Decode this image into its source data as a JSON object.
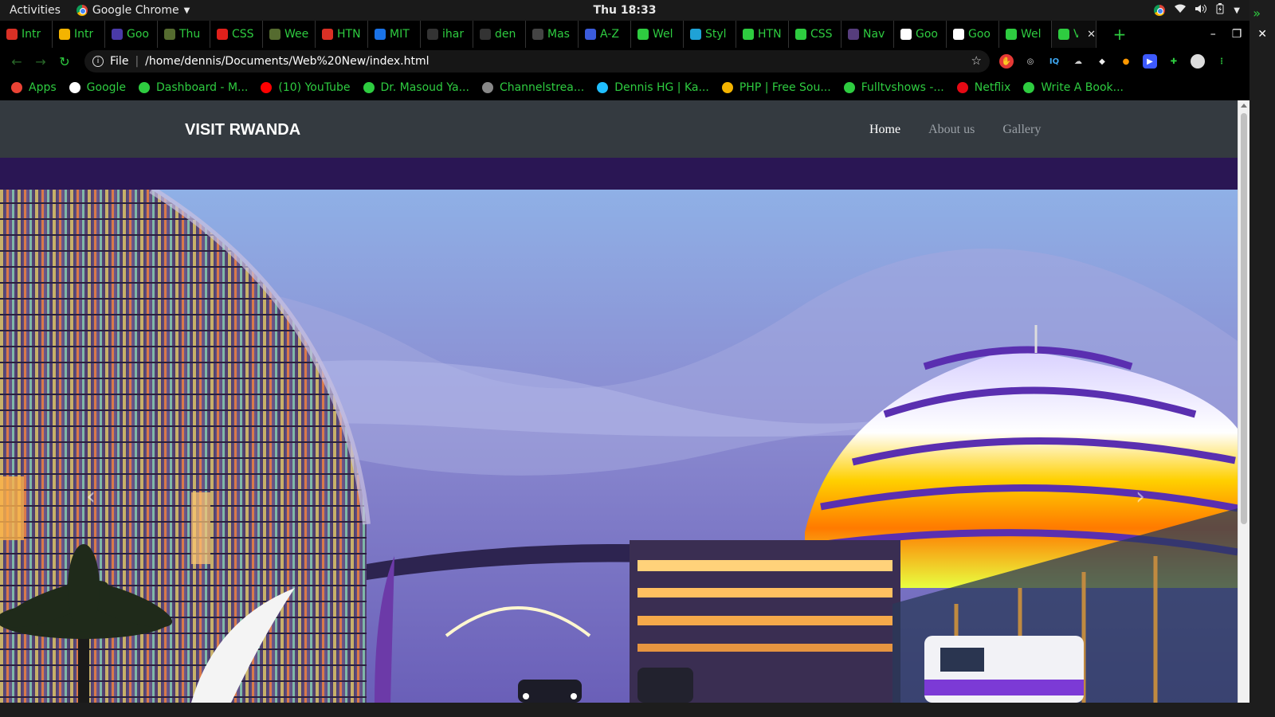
{
  "system_bar": {
    "activities": "Activities",
    "app_name": "Google Chrome",
    "clock": "Thu 18:33"
  },
  "tabs": [
    {
      "label": "Intr",
      "icon": "gmail-icon",
      "color": "#d93025"
    },
    {
      "label": "Intr",
      "icon": "slides-icon",
      "color": "#f4b400"
    },
    {
      "label": "Goo",
      "icon": "calendar-icon",
      "color": "#4a3aa8"
    },
    {
      "label": "Thu",
      "icon": "plant-icon",
      "color": "#556b2f"
    },
    {
      "label": "CSS",
      "icon": "opera-icon",
      "color": "#e0201b"
    },
    {
      "label": "Wee",
      "icon": "plant-icon",
      "color": "#556b2f"
    },
    {
      "label": "HTN",
      "icon": "ring-icon",
      "color": "#d93025"
    },
    {
      "label": "MIT",
      "icon": "question-icon",
      "color": "#1a73e8"
    },
    {
      "label": "ihar",
      "icon": "github-icon",
      "color": "#333333"
    },
    {
      "label": "den",
      "icon": "github-icon",
      "color": "#333333"
    },
    {
      "label": "Mas",
      "icon": "github-icon",
      "color": "#444444"
    },
    {
      "label": "A-Z",
      "icon": "info-icon",
      "color": "#3b5bdb"
    },
    {
      "label": "Wel",
      "icon": "globe-icon",
      "color": "#2ecc40"
    },
    {
      "label": "Styl",
      "icon": "puzzle-icon",
      "color": "#1fa2d6"
    },
    {
      "label": "HTN",
      "icon": "w3-icon",
      "color": "#2ecc40"
    },
    {
      "label": "CSS",
      "icon": "w3-icon",
      "color": "#2ecc40"
    },
    {
      "label": "Nav",
      "icon": "bootstrap-icon",
      "color": "#563d7c"
    },
    {
      "label": "Goo",
      "icon": "google-icon",
      "color": "#ffffff"
    },
    {
      "label": "Goo",
      "icon": "google-icon",
      "color": "#ffffff"
    },
    {
      "label": "Wel",
      "icon": "globe-icon",
      "color": "#2ecc40"
    },
    {
      "label": "V",
      "icon": "globe-icon",
      "color": "#2ecc40",
      "active": true
    }
  ],
  "toolbar": {
    "scheme": "File",
    "url": "/home/dennis/Documents/Web%20New/index.html"
  },
  "bookmarks": [
    {
      "label": "Apps",
      "icon": "apps-grid-icon",
      "color": "#ea4335"
    },
    {
      "label": "Google",
      "icon": "google-icon",
      "color": "#ffffff"
    },
    {
      "label": "Dashboard - M...",
      "icon": "dashboard-icon",
      "color": "#2ecc40"
    },
    {
      "label": "(10) YouTube",
      "icon": "youtube-icon",
      "color": "#ff0000"
    },
    {
      "label": "Dr. Masoud Ya...",
      "icon": "globe-icon",
      "color": "#2ecc40"
    },
    {
      "label": "Channelstrea...",
      "icon": "channel-icon",
      "color": "#888888"
    },
    {
      "label": "Dennis HG | Ka...",
      "icon": "kaggle-icon",
      "color": "#20beff"
    },
    {
      "label": "PHP | Free Sou...",
      "icon": "php-icon",
      "color": "#f4b400"
    },
    {
      "label": "Fulltvshows -...",
      "icon": "globe-icon",
      "color": "#2ecc40"
    },
    {
      "label": "Netflix",
      "icon": "netflix-icon",
      "color": "#e50914"
    },
    {
      "label": "Write A Book...",
      "icon": "book-icon",
      "color": "#2ecc40"
    }
  ],
  "page": {
    "brand": "VISIT RWANDA",
    "nav": [
      {
        "label": "Home",
        "active": true
      },
      {
        "label": "About us",
        "active": false
      },
      {
        "label": "Gallery",
        "active": false
      }
    ],
    "colors": {
      "navbar": "#343a40",
      "band": "#2a1654"
    }
  }
}
